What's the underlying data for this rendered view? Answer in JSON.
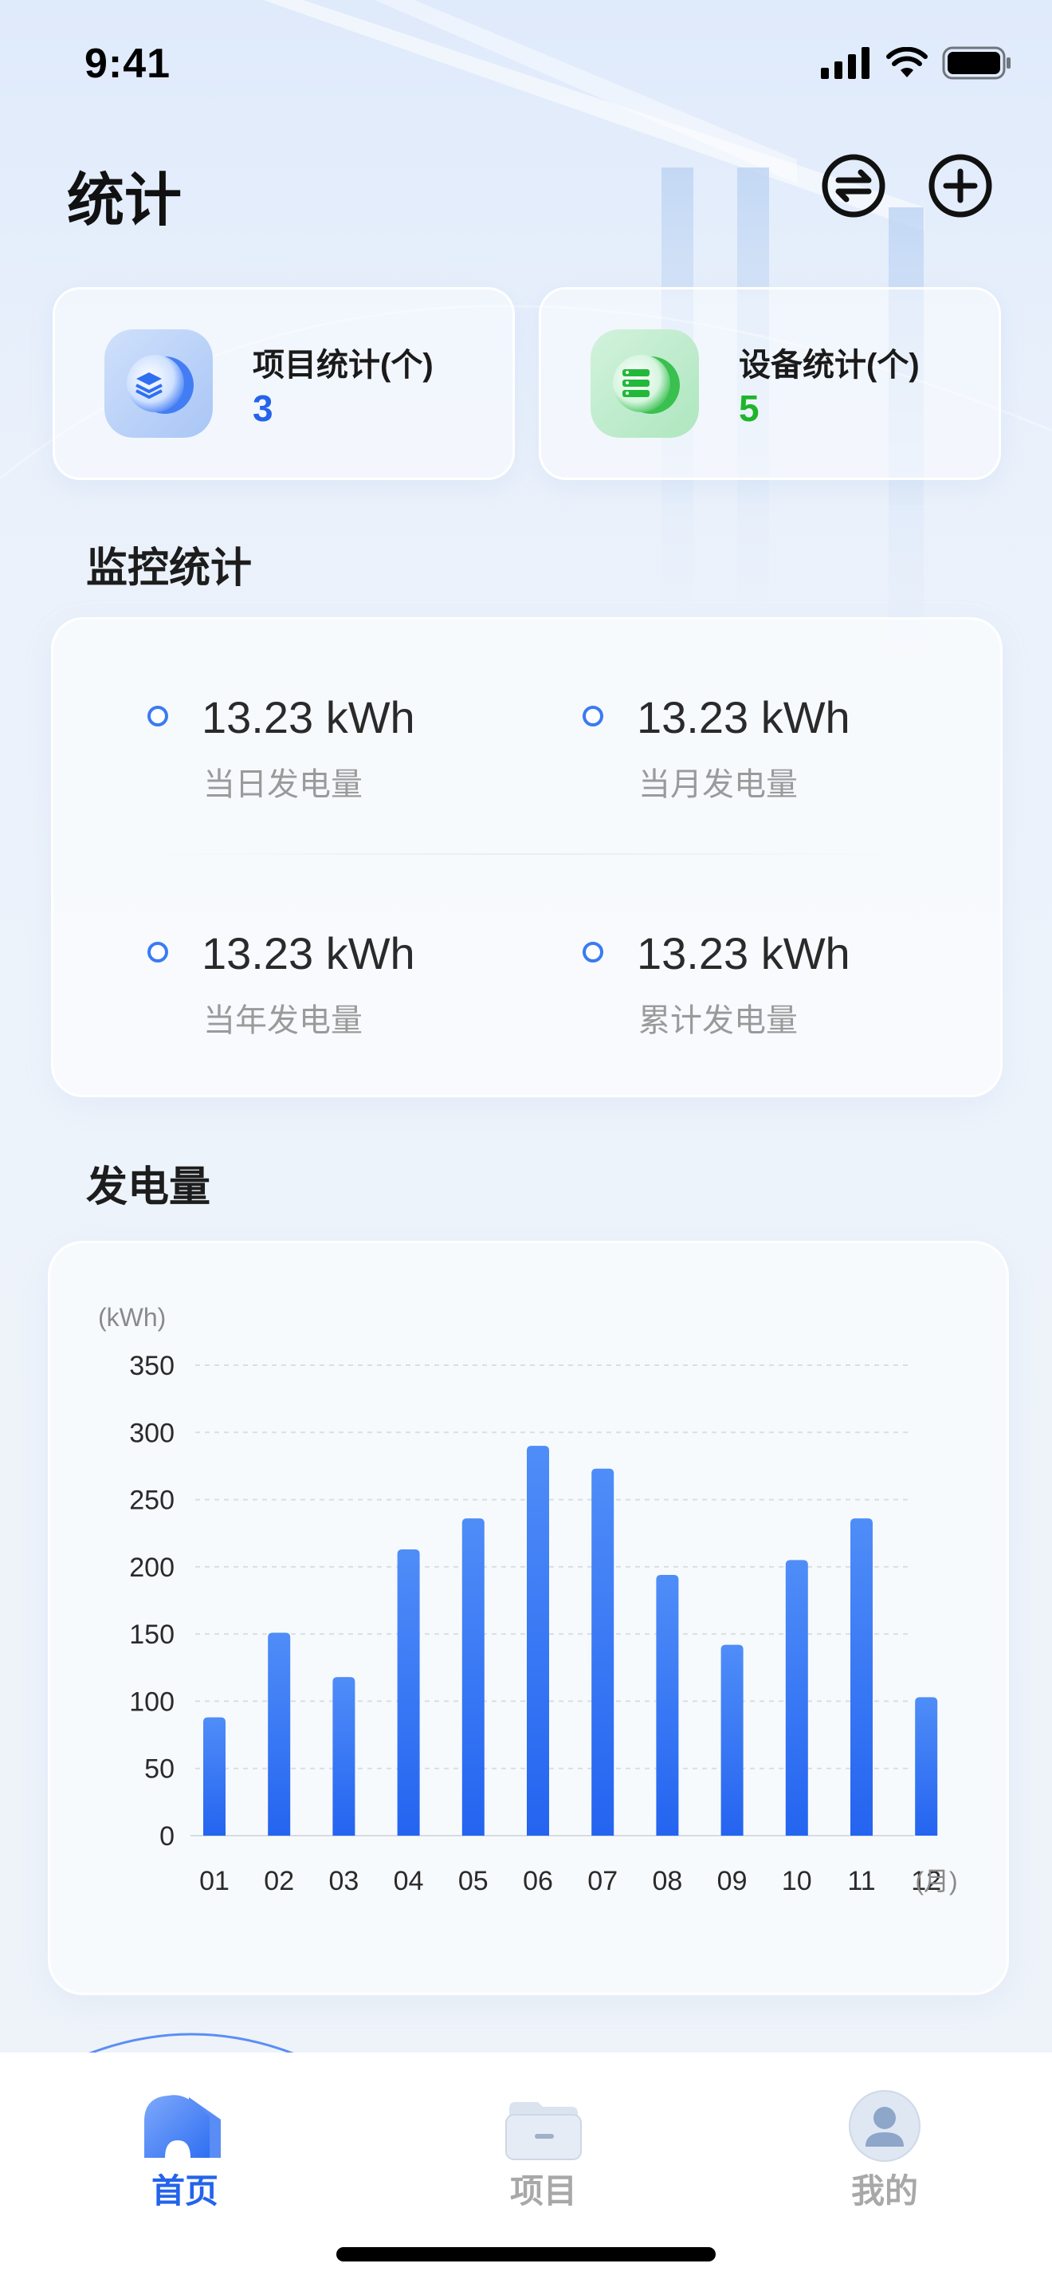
{
  "status_bar": {
    "time": "9:41"
  },
  "header": {
    "title": "统计"
  },
  "stat_cards": [
    {
      "label": "项目统计(个)",
      "value": "3",
      "color": "#2463eb",
      "icon": "stack-layers-icon"
    },
    {
      "label": "设备统计(个)",
      "value": "5",
      "color": "#1fb52a",
      "icon": "server-list-icon"
    }
  ],
  "monitor": {
    "title": "监控统计",
    "items": [
      {
        "value": "13.23 kWh",
        "label": "当日发电量"
      },
      {
        "value": "13.23 kWh",
        "label": "当月发电量"
      },
      {
        "value": "13.23 kWh",
        "label": "当年发电量"
      },
      {
        "value": "13.23 kWh",
        "label": "累计发电量"
      }
    ]
  },
  "generation": {
    "title": "发电量"
  },
  "chart_data": {
    "type": "bar",
    "title": "",
    "ylabel": "(kWh)",
    "xlabel": "(月)",
    "categories": [
      "01",
      "02",
      "03",
      "04",
      "05",
      "06",
      "07",
      "08",
      "09",
      "10",
      "11",
      "12"
    ],
    "values": [
      88,
      151,
      118,
      213,
      236,
      290,
      273,
      194,
      142,
      205,
      236,
      103
    ],
    "ylim": [
      0,
      350
    ],
    "yticks": [
      0,
      50,
      100,
      150,
      200,
      250,
      300,
      350
    ],
    "grid": true,
    "bar_color": "#2f6ff2"
  },
  "tabbar": {
    "items": [
      {
        "label": "首页",
        "active": true
      },
      {
        "label": "项目",
        "active": false
      },
      {
        "label": "我的",
        "active": false
      }
    ],
    "active_color": "#2463eb",
    "inactive_color": "#a8a8a8"
  }
}
